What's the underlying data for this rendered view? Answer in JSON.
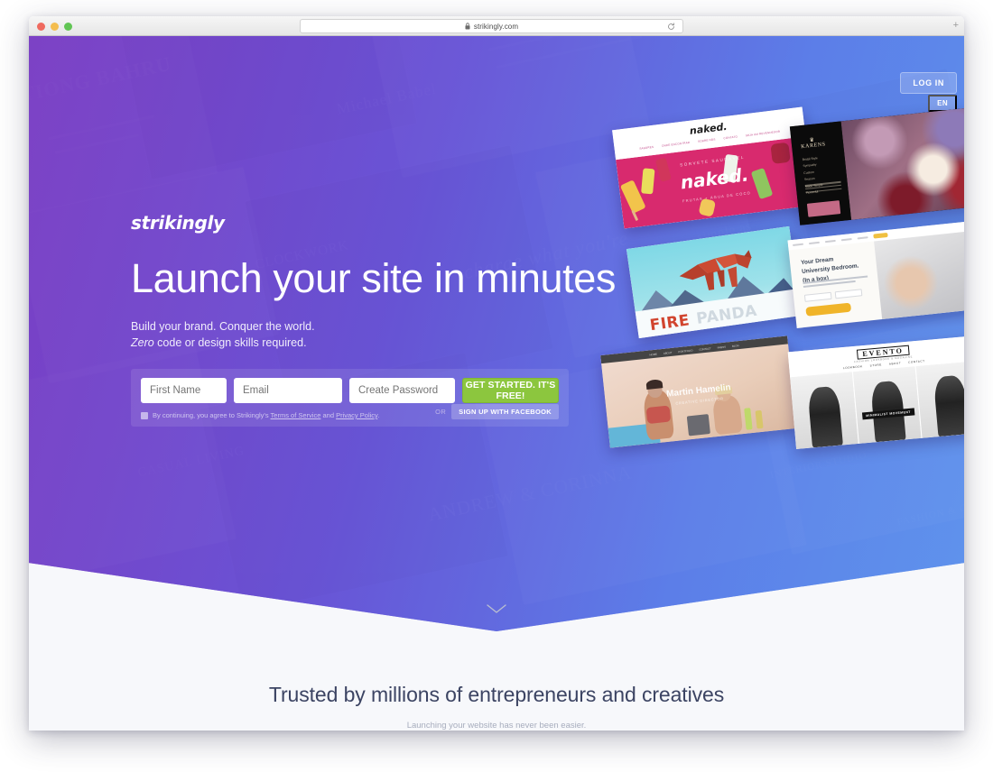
{
  "browser": {
    "url": "strikingly.com",
    "lock_icon": "lock-icon",
    "reload_icon": "reload-icon",
    "newtab_label": "+",
    "traffic_lights": [
      "close",
      "minimize",
      "zoom"
    ]
  },
  "hero": {
    "brand": "strikingly",
    "headline": "Launch your site in minutes",
    "sub_line1": "Build your brand. Conquer the world.",
    "sub_line2_em": "Zero",
    "sub_line2_rest": " code or design skills required.",
    "login_label": "LOG IN",
    "lang_label": "EN",
    "colors": {
      "gradient_start": "#7b3fc4",
      "gradient_end": "#5f93ec",
      "cta_green": "#8cc63e"
    }
  },
  "signup": {
    "first_name_placeholder": "First Name",
    "email_placeholder": "Email",
    "password_placeholder": "Create Password",
    "cta_label": "GET STARTED. IT'S FREE!",
    "legal_prefix": "By continuing, you agree to Strikingly's ",
    "legal_terms": "Terms of Service",
    "legal_and": " and ",
    "legal_privacy": "Privacy Policy",
    "legal_suffix": ".",
    "or_label": "OR",
    "facebook_label": "SIGN UP WITH FACEBOOK"
  },
  "showcase": {
    "cards": [
      {
        "name": "naked",
        "logo": "naked.",
        "kicker": "SORVETE SAUDÁVEL",
        "wordmark": "naked.",
        "tagline": "FRUTAS + ÁGUA DE COCO",
        "menu": [
          "SABORES",
          "ONDE ENCONTRAR",
          "SOBRE NÓS",
          "CONTATO",
          "SEJA UM REVENDEDOR"
        ]
      },
      {
        "name": "florist",
        "logo": "KARENS",
        "links": [
          "Bridal Style",
          "Sympathy",
          "Custom",
          "Season",
          "Made Simple",
          "Flowerful"
        ]
      },
      {
        "name": "fire-panda",
        "title_fire": "FIRE",
        "title_panda": "PANDA"
      },
      {
        "name": "dream-bedroom",
        "heading_line1": "Your Dream",
        "heading_line2": "University Bedroom.",
        "heading_line3": "(In a box)"
      },
      {
        "name": "martin-hamelin",
        "title": "Martin Hamelin",
        "role": "CREATIVE DIRECTOR",
        "menu": [
          "HOME",
          "ABOUT",
          "PORTFOLIO",
          "CONTACT",
          "PRESS",
          "BLOG"
        ]
      },
      {
        "name": "evento-lookbook",
        "logo": "EVENTO",
        "sub": "FASHION LOOKBOOK & MAGAZINE",
        "menu": [
          "LOOKBOOK",
          "STORE",
          "ABOUT",
          "CONTACT"
        ],
        "caption": "MINIMALIST MOVEMENT"
      }
    ]
  },
  "lower": {
    "heading": "Trusted by millions of entrepreneurs and creatives",
    "subheading": "Launching your website has never been easier."
  }
}
